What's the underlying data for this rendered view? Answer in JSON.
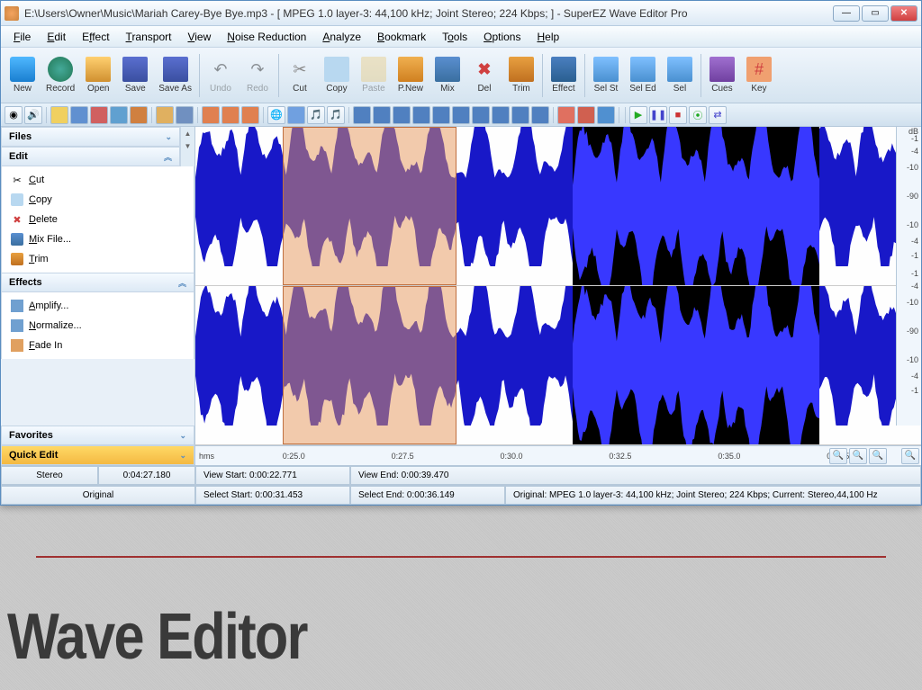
{
  "window": {
    "title": "E:\\Users\\Owner\\Music\\Mariah Carey-Bye Bye.mp3 - [ MPEG 1.0 layer-3: 44,100 kHz; Joint Stereo; 224 Kbps; ] - SuperEZ Wave Editor Pro"
  },
  "menu": {
    "file": "File",
    "edit": "Edit",
    "effect": "Effect",
    "transport": "Transport",
    "view": "View",
    "noise": "Noise Reduction",
    "analyze": "Analyze",
    "bookmark": "Bookmark",
    "tools": "Tools",
    "options": "Options",
    "help": "Help"
  },
  "toolbar": {
    "new": "New",
    "record": "Record",
    "open": "Open",
    "save": "Save",
    "saveas": "Save As",
    "undo": "Undo",
    "redo": "Redo",
    "cut": "Cut",
    "copy": "Copy",
    "paste": "Paste",
    "pnew": "P.New",
    "mix": "Mix",
    "del": "Del",
    "trim": "Trim",
    "effect": "Effect",
    "selst": "Sel St",
    "seled": "Sel Ed",
    "sel": "Sel",
    "cues": "Cues",
    "key": "Key"
  },
  "sidebar": {
    "files": "Files",
    "edit_header": "Edit",
    "edit_items": {
      "cut": "Cut",
      "copy": "Copy",
      "delete": "Delete",
      "mix": "Mix File...",
      "trim": "Trim"
    },
    "effects_header": "Effects",
    "effects_items": {
      "amplify": "Amplify...",
      "normalize": "Normalize...",
      "fadein": "Fade In"
    },
    "favorites": "Favorites",
    "quickedit": "Quick Edit"
  },
  "db_scale": {
    "label": "dB",
    "ticks": [
      "-1",
      "-4",
      "-10",
      "-90",
      "-10",
      "-4",
      "-1",
      "-1",
      "-4",
      "-10",
      "-90",
      "-10",
      "-4",
      "-1"
    ]
  },
  "timeline": {
    "unit": "hms",
    "ticks": [
      "0:25.0",
      "0:27.5",
      "0:30.0",
      "0:32.5",
      "0:35.0",
      "0:37.5"
    ]
  },
  "status": {
    "stereo": "Stereo",
    "duration": "0:04:27.180",
    "viewstart": "View Start: 0:00:22.771",
    "viewend": "View End: 0:00:39.470",
    "original_label": "Original",
    "selstart": "Select Start: 0:00:31.453",
    "selend": "Select End: 0:00:36.149",
    "fileinfo": "Original: MPEG 1.0 layer-3: 44,100 kHz; Joint Stereo; 224 Kbps;  Current: Stereo,44,100 Hz"
  },
  "slide": {
    "title": "Wave Editor"
  }
}
